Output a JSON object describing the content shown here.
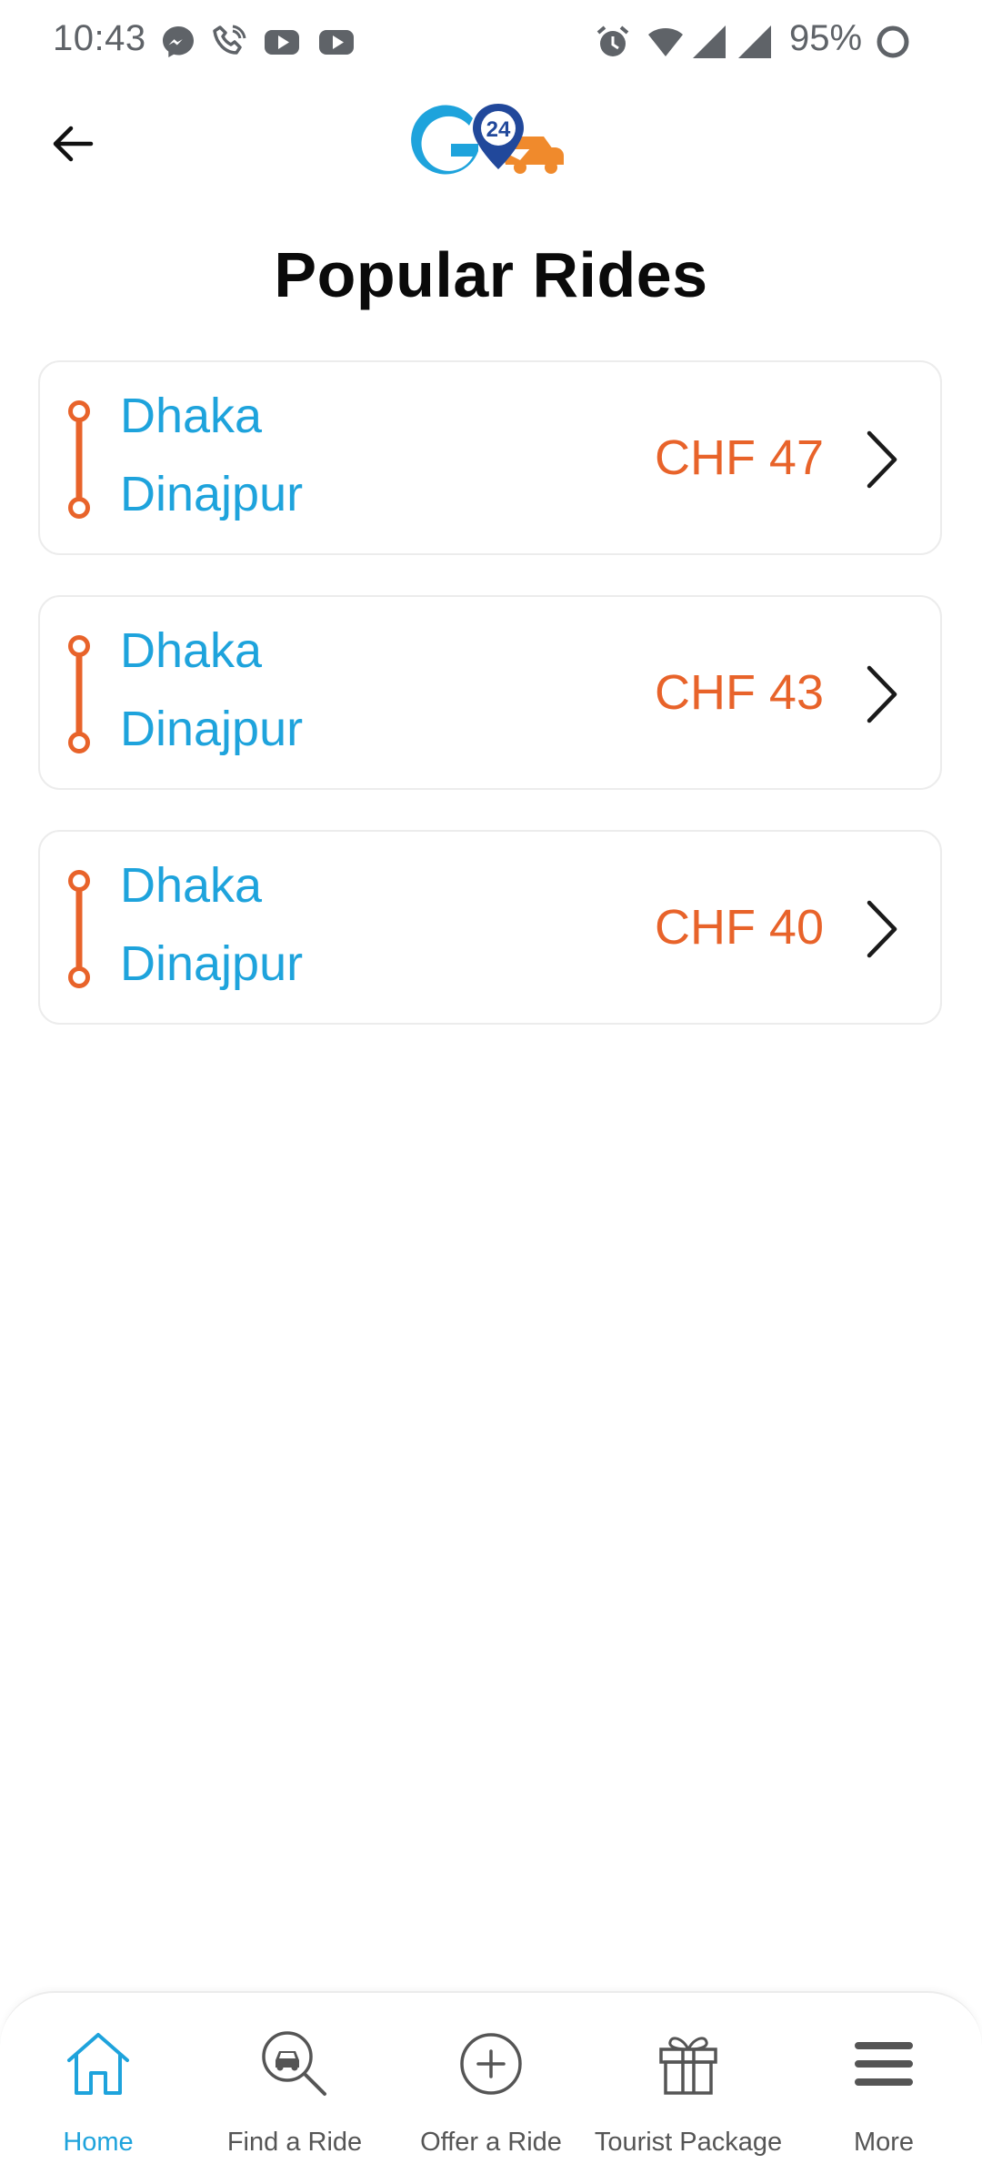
{
  "status_bar": {
    "time": "10:43",
    "battery": "95%",
    "icons": [
      "messenger-icon",
      "wifi-call-icon",
      "youtube-icon",
      "youtube-icon",
      "alarm-icon",
      "wifi-icon",
      "signal-icon",
      "signal-icon",
      "battery-icon"
    ]
  },
  "header": {
    "back_icon": "arrow-left-icon",
    "logo_text": "24",
    "title": "Popular Rides"
  },
  "rides": [
    {
      "from": "Dhaka",
      "to": "Dinajpur",
      "price": "CHF 47"
    },
    {
      "from": "Dhaka",
      "to": "Dinajpur",
      "price": "CHF 43"
    },
    {
      "from": "Dhaka",
      "to": "Dinajpur",
      "price": "CHF 40"
    }
  ],
  "bottom_nav": [
    {
      "label": "Home",
      "icon": "home-icon",
      "active": true
    },
    {
      "label": "Find a Ride",
      "icon": "car-search-icon",
      "active": false
    },
    {
      "label": "Offer a Ride",
      "icon": "plus-circle-icon",
      "active": false
    },
    {
      "label": "Tourist Package",
      "icon": "gift-icon",
      "active": false
    },
    {
      "label": "More",
      "icon": "menu-icon",
      "active": false
    }
  ],
  "colors": {
    "accent_blue": "#1ea3dc",
    "accent_orange": "#e8632a",
    "title": "#0a0a0a",
    "nav_text": "#555555"
  }
}
